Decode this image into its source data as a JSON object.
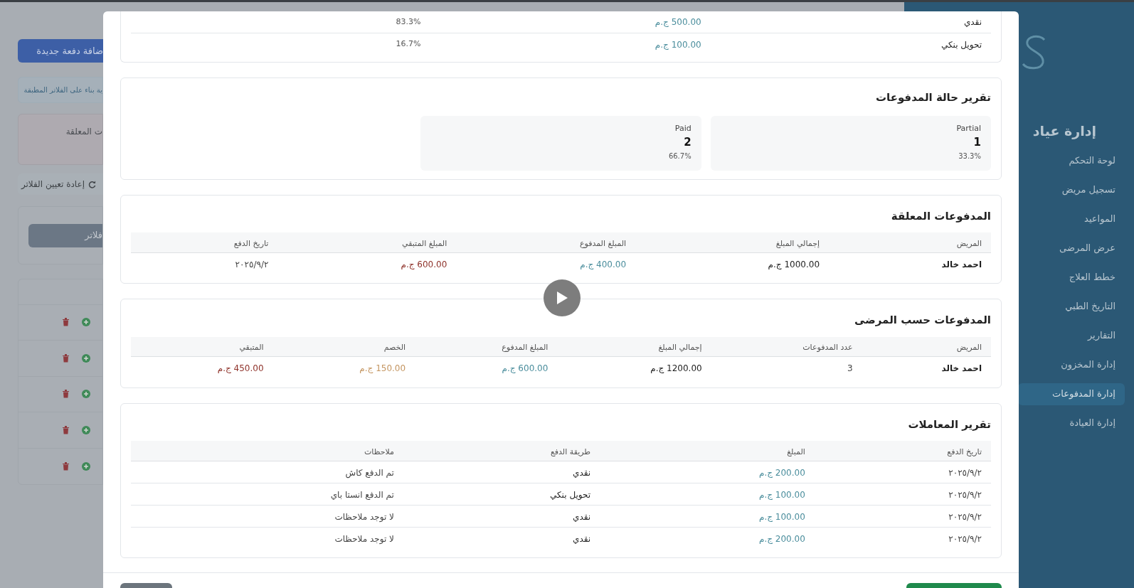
{
  "background_page": {
    "add_button": "ضافة دفعة جديدة",
    "filter_note": "ية بناء على الفلاتر المطبقة",
    "pending_card_title": "ت المعلقة",
    "reset_filters": "إعادة تعيين الفلاتر",
    "filter_button": "فلاتر"
  },
  "sidebar": {
    "title": "إدارة عياد",
    "items": [
      {
        "label": "لوحة التحكم",
        "selected": false
      },
      {
        "label": "تسجيل مريض",
        "selected": false
      },
      {
        "label": "المواعيد",
        "selected": false
      },
      {
        "label": "عرض المرضى",
        "selected": false
      },
      {
        "label": "خطط العلاج",
        "selected": false
      },
      {
        "label": "التاريخ الطبي",
        "selected": false
      },
      {
        "label": "التقارير",
        "selected": false
      },
      {
        "label": "إدارة المخزون",
        "selected": false
      },
      {
        "label": "إدارة المدفوعات",
        "selected": true
      },
      {
        "label": "إدارة العيادة",
        "selected": false
      }
    ]
  },
  "modal": {
    "method_rows": [
      {
        "method": "نقدي",
        "amount": "500.00 ج.م",
        "share": "83.3%"
      },
      {
        "method": "تحويل بنكي",
        "amount": "100.00 ج.م",
        "share": "16.7%"
      }
    ],
    "status_report": {
      "title": "تقرير حالة المدفوعات",
      "statuses": [
        {
          "label": "Partial",
          "count": "1",
          "share": "33.3%"
        },
        {
          "label": "Paid",
          "count": "2",
          "share": "66.7%"
        }
      ]
    },
    "tables": [
      {
        "title": "المدفوعات المعلقة",
        "columns": [
          {
            "label": "المريض",
            "kind": "name"
          },
          {
            "label": "إجمالي المبلغ",
            "kind": "total"
          },
          {
            "label": "المبلغ المدفوع",
            "kind": "paid"
          },
          {
            "label": "المبلغ المتبقي",
            "kind": "remaining"
          },
          {
            "label": "تاريخ الدفع",
            "kind": "plain"
          }
        ],
        "rows": [
          [
            "احمد خالد",
            "1000.00 ج.م",
            "400.00 ج.م",
            "600.00 ج.م",
            "٢٠٢٥/٩/٢"
          ]
        ]
      },
      {
        "title": "المدفوعات حسب المرضى",
        "columns": [
          {
            "label": "المريض",
            "kind": "name"
          },
          {
            "label": "عدد المدفوعات",
            "kind": "plain"
          },
          {
            "label": "إجمالي المبلغ",
            "kind": "total"
          },
          {
            "label": "المبلغ المدفوع",
            "kind": "paid"
          },
          {
            "label": "الخصم",
            "kind": "discount"
          },
          {
            "label": "المتبقي",
            "kind": "remaining"
          }
        ],
        "rows": [
          [
            "احمد خالد",
            "3",
            "1200.00 ج.م",
            "600.00 ج.م",
            "150.00 ج.م",
            "450.00 ج.م"
          ]
        ]
      },
      {
        "title": "تقرير المعاملات",
        "columns": [
          {
            "label": "تاريخ الدفع",
            "kind": "plain"
          },
          {
            "label": "المبلغ",
            "kind": "paid"
          },
          {
            "label": "طريقة الدفع",
            "kind": "total"
          },
          {
            "label": "ملاحظات",
            "kind": "plain"
          }
        ],
        "rows": [
          [
            "٢٠٢٥/٩/٢",
            "200.00 ج.م",
            "نقدي",
            "تم الدفع كاش"
          ],
          [
            "٢٠٢٥/٩/٢",
            "100.00 ج.م",
            "تحويل بنكي",
            "تم الدفع انستا باي"
          ],
          [
            "٢٠٢٥/٩/٢",
            "100.00 ج.م",
            "نقدي",
            "لا توجد ملاحظات"
          ],
          [
            "٢٠٢٥/٩/٢",
            "200.00 ج.م",
            "نقدي",
            "لا توجد ملاحظات"
          ]
        ]
      }
    ]
  }
}
